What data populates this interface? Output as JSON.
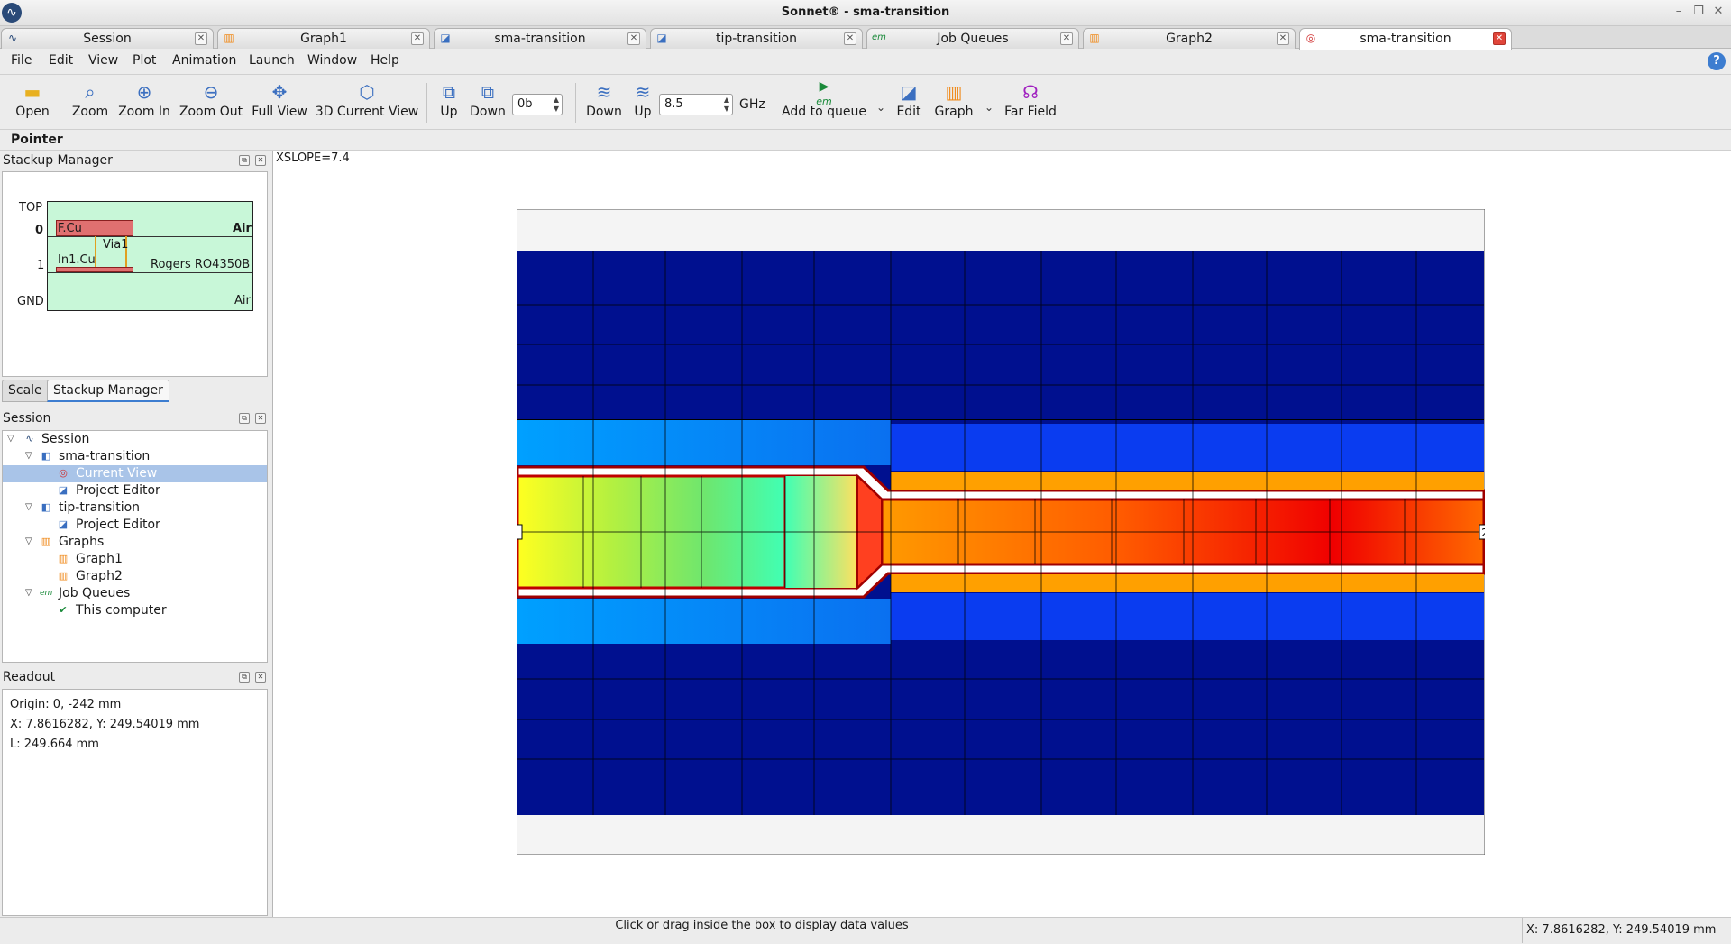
{
  "window": {
    "title": "Sonnet® - sma-transition"
  },
  "tabs": [
    {
      "label": "Session",
      "icon": "session-icon"
    },
    {
      "label": "Graph1",
      "icon": "graph-icon"
    },
    {
      "label": "sma-transition",
      "icon": "project-editor-icon"
    },
    {
      "label": "tip-transition",
      "icon": "project-editor-icon"
    },
    {
      "label": "Job Queues",
      "icon": "em-icon"
    },
    {
      "label": "Graph2",
      "icon": "graph-icon"
    },
    {
      "label": "sma-transition",
      "icon": "current-view-icon",
      "active": true
    }
  ],
  "menu": [
    "File",
    "Edit",
    "View",
    "Plot",
    "Animation",
    "Launch",
    "Window",
    "Help"
  ],
  "toolbar": {
    "open": "Open",
    "zoom": "Zoom",
    "zoom_in": "Zoom In",
    "zoom_out": "Zoom Out",
    "full_view": "Full View",
    "current_3d": "3D Current View",
    "level_up": "Up",
    "level_down": "Down",
    "level_value": "0b",
    "freq_down": "Down",
    "freq_up": "Up",
    "freq_value": "8.5",
    "freq_unit": "GHz",
    "add_to_queue": "Add to queue",
    "em_label": "em",
    "edit": "Edit",
    "graph": "Graph",
    "far_field": "Far Field"
  },
  "pointer_mode": "Pointer",
  "stackup": {
    "title": "Stackup Manager",
    "labels": {
      "top": "TOP",
      "level0": "0",
      "level1": "1",
      "gnd": "GND",
      "fcu": "F.Cu",
      "via": "Via1",
      "in1cu": "In1.Cu",
      "air_top": "Air",
      "dielectric": "Rogers RO4350B",
      "air_bottom": "Air"
    },
    "tabs": [
      "Scale",
      "Stackup Manager"
    ]
  },
  "session": {
    "title": "Session",
    "tree": [
      {
        "label": "Session",
        "depth": 0,
        "expanded": true,
        "icon": "session-icon"
      },
      {
        "label": "sma-transition",
        "depth": 1,
        "expanded": true,
        "icon": "project-icon"
      },
      {
        "label": "Current View",
        "depth": 2,
        "icon": "current-view-icon",
        "selected": true
      },
      {
        "label": "Project Editor",
        "depth": 2,
        "icon": "project-editor-icon"
      },
      {
        "label": "tip-transition",
        "depth": 1,
        "expanded": true,
        "icon": "project-icon"
      },
      {
        "label": "Project Editor",
        "depth": 2,
        "icon": "project-editor-icon"
      },
      {
        "label": "Graphs",
        "depth": 1,
        "expanded": true,
        "icon": "graph-icon"
      },
      {
        "label": "Graph1",
        "depth": 2,
        "icon": "graph-icon"
      },
      {
        "label": "Graph2",
        "depth": 2,
        "icon": "graph-icon"
      },
      {
        "label": "Job Queues",
        "depth": 1,
        "expanded": true,
        "icon": "em-icon"
      },
      {
        "label": "This computer",
        "depth": 2,
        "icon": "check-icon"
      }
    ]
  },
  "readout": {
    "title": "Readout",
    "origin": "Origin: 0, -242 mm",
    "xy": "X: 7.8616282, Y: 249.54019 mm",
    "length": "L: 249.664 mm"
  },
  "canvas": {
    "xslope": "XSLOPE=7.4",
    "port1": "1",
    "port2": "2"
  },
  "status": {
    "message": "Click or drag inside the box to display data values",
    "coords": "X: 7.8616282, Y: 249.54019 mm"
  },
  "colors": {
    "dark_blue": "#000f96",
    "blue": "#0a3cf0",
    "light_blue": "#0a82f0",
    "yellow": "#fafa1e",
    "green": "#64e664",
    "orange": "#fa9600",
    "red": "#f00000",
    "stack_air": "#c8f7d8",
    "stack_metal": "#e07070"
  }
}
